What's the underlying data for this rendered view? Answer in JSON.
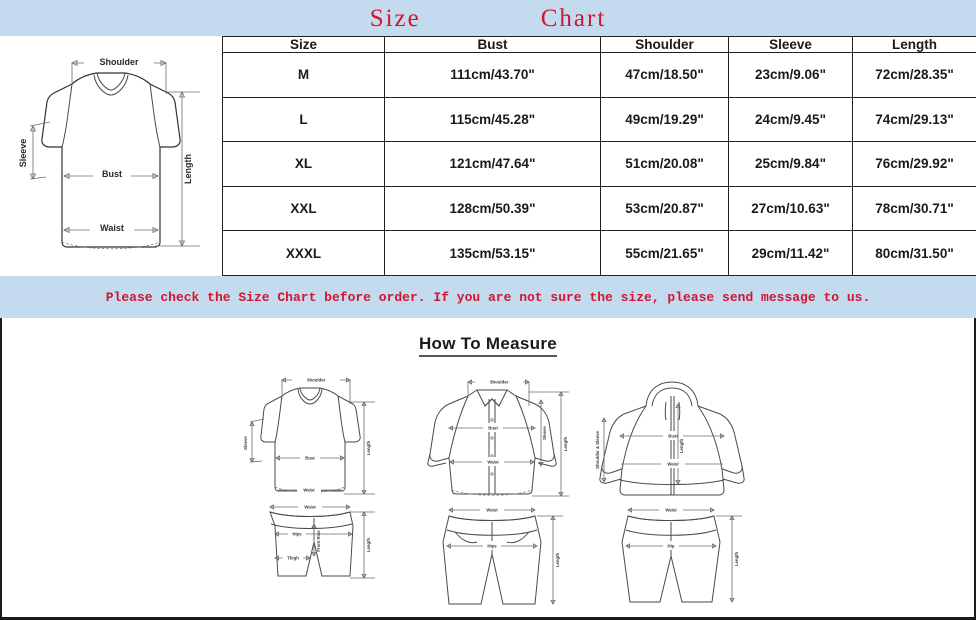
{
  "colors": {
    "band": "#c4daee",
    "title_red": "#cf1731",
    "notice_red": "#cf1731",
    "table_border": "#231f20",
    "panel_border": "#1b1b1b"
  },
  "header": {
    "title_word_1": "Size",
    "title_word_2": "Chart"
  },
  "garment_diagram": {
    "label_shoulder": "Shoulder",
    "label_sleeve": "Sleeve",
    "label_bust": "Bust",
    "label_waist": "Waist",
    "label_length": "Length"
  },
  "table": {
    "columns": [
      "Size",
      "Bust",
      "Shoulder",
      "Sleeve",
      "Length"
    ],
    "rows": [
      {
        "size": "M",
        "bust": "111cm/43.70\"",
        "shoulder": "47cm/18.50\"",
        "sleeve": "23cm/9.06\"",
        "length": "72cm/28.35\""
      },
      {
        "size": "L",
        "bust": "115cm/45.28\"",
        "shoulder": "49cm/19.29\"",
        "sleeve": "24cm/9.45\"",
        "length": "74cm/29.13\""
      },
      {
        "size": "XL",
        "bust": "121cm/47.64\"",
        "shoulder": "51cm/20.08\"",
        "sleeve": "25cm/9.84\"",
        "length": "76cm/29.92\""
      },
      {
        "size": "XXL",
        "bust": "128cm/50.39\"",
        "shoulder": "53cm/20.87\"",
        "sleeve": "27cm/10.63\"",
        "length": "78cm/30.71\""
      },
      {
        "size": "XXXL",
        "bust": "135cm/53.15\"",
        "shoulder": "55cm/21.65\"",
        "sleeve": "29cm/11.42\"",
        "length": "80cm/31.50\""
      }
    ]
  },
  "notice": {
    "text": "Please check the Size Chart before order. If you are not sure the size, please send message to us."
  },
  "how_to_measure": {
    "heading": "How To Measure",
    "tshirt": {
      "shoulder": "Shoulder",
      "sleeve": "Sleeve",
      "bust": "Bust",
      "length": "Length",
      "waist": "Waist"
    },
    "shorts": {
      "waist": "Waist",
      "hips": "Hips",
      "front_rise": "Front Rise",
      "thigh": "Thigh",
      "length": "Length"
    },
    "shirt": {
      "shoulder": "Shoulder",
      "bust": "Bust",
      "waist": "Waist",
      "sleeve": "Sleeve",
      "length": "Length"
    },
    "pants": {
      "waist": "Waist",
      "hips": "Hips",
      "length": "Length"
    },
    "hoodie": {
      "shoulder_sleeve": "Shoulder & Sleeve",
      "bust": "Bust",
      "length": "Length",
      "waist": "Waist"
    },
    "sweatpants": {
      "waist": "Waist",
      "hip": "Hip",
      "length": "Length"
    }
  }
}
